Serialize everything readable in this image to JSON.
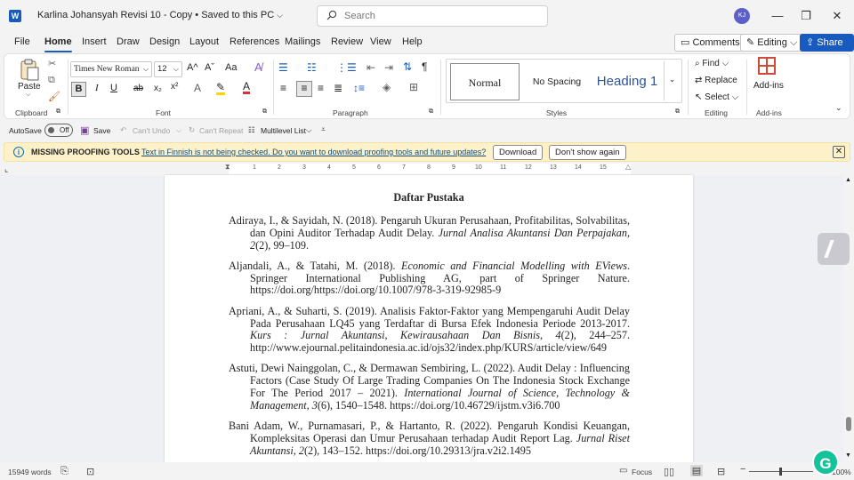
{
  "title_bar": {
    "app_icon": "W",
    "doc_name": "Karlina Johansyah Revisi 10 - Copy • Saved to this PC",
    "search_placeholder": "Search",
    "user_initials": "KJ",
    "minimize": "—",
    "restore": "❐",
    "close": "✕"
  },
  "menu": {
    "tabs": [
      "File",
      "Home",
      "Insert",
      "Draw",
      "Design",
      "Layout",
      "References",
      "Mailings",
      "Review",
      "View",
      "Help"
    ],
    "active_tab": "Home",
    "comments": "Comments",
    "editing": "Editing",
    "share": "Share"
  },
  "ribbon": {
    "clipboard": {
      "paste": "Paste",
      "label": "Clipboard"
    },
    "font": {
      "family": "Times New Roman",
      "size": "12",
      "label": "Font",
      "bold": "B",
      "italic": "I",
      "underline": "U",
      "strike": "ab",
      "sub": "x₂",
      "sup": "x²",
      "grow": "A^",
      "shrink": "Aˇ",
      "case": "Aa"
    },
    "paragraph": {
      "label": "Paragraph"
    },
    "styles": {
      "label": "Styles",
      "items": [
        "Normal",
        "No Spacing",
        "Heading 1"
      ]
    },
    "editing": {
      "label": "Editing",
      "find": "Find",
      "replace": "Replace",
      "select": "Select"
    },
    "addins": {
      "label": "Add-ins",
      "button": "Add-ins"
    }
  },
  "qat": {
    "autosave": "AutoSave",
    "autosave_state": "Off",
    "save": "Save",
    "undo": "Can't Undo",
    "repeat": "Can't Repeat",
    "multilevel": "Multilevel List"
  },
  "notification": {
    "title": "MISSING PROOFING TOOLS",
    "message": "Text in Finnish is not being checked. Do you want to download proofing tools and future updates?",
    "download": "Download",
    "dont_show": "Don't show again"
  },
  "ruler": {
    "numbers": [
      "1",
      "2",
      "3",
      "4",
      "5",
      "6",
      "7",
      "8",
      "9",
      "10",
      "11",
      "12",
      "13",
      "14",
      "15"
    ]
  },
  "document": {
    "heading": "Daftar Pustaka",
    "references": [
      {
        "a": "Adiraya, I., & Sayidah, N. (2018). Pengaruh Ukuran Perusahaan, Profitabilitas, Solvabilitas, dan Opini Auditor Terhadap Audit Delay. ",
        "i": "Jurnal Analisa Akuntansi Dan Perpajakan",
        "b": ", ",
        "vol": "2",
        "c": "(2), 99–109."
      },
      {
        "a": "Aljandali, A., & Tatahi, M. (2018). ",
        "i": "Economic and Financial Modelling with EViews",
        "b": ". Springer International Publishing AG, part of Springer Nature. https://doi.org/https://doi.org/10.1007/978-3-319-92985-9",
        "vol": "",
        "c": ""
      },
      {
        "a": "Apriani, A., & Suharti, S. (2019). Analisis Faktor-Faktor yang Mempengaruhi Audit Delay Pada Perusahaan LQ45 yang Terdaftar di Bursa Efek Indonesia Periode 2013-2017. ",
        "i": "Kurs : Jurnal Akuntansi, Kewirausahaan Dan Bisnis",
        "b": ", ",
        "vol": "4",
        "c": "(2), 244–257. http://www.ejournal.pelitaindonesia.ac.id/ojs32/index.php/KURS/article/view/649"
      },
      {
        "a": "Astuti, Dewi Nainggolan, C., & Dermawan Sembiring, L. (2022). Audit Delay : Influencing Factors (Case Study Of Large Trading Companies On The Indonesia Stock Exchange For The Period 2017 – 2021). ",
        "i": "International Journal of Science, Technology & Management",
        "b": ", ",
        "vol": "3",
        "c": "(6), 1540–1548. https://doi.org/10.46729/ijstm.v3i6.700"
      },
      {
        "a": "Bani Adam, W., Purnamasari, P., & Hartanto, R. (2022). Pengaruh Kondisi Keuangan, Kompleksitas Operasi dan Umur Perusahaan terhadap Audit Report Lag. ",
        "i": "Jurnal Riset Akuntansi",
        "b": ", ",
        "vol": "2",
        "c": "(2), 143–152. https://doi.org/10.29313/jra.v2i2.1495"
      }
    ]
  },
  "status": {
    "words": "15949 words",
    "focus": "Focus",
    "zoom": "100%",
    "zoom_minus": "−",
    "zoom_plus": "+"
  },
  "grammarly": "G",
  "colors": {
    "accent": "#185abd",
    "notify_bg": "#fcf1c8",
    "heading_style": "#2f5496",
    "grammarly": "#15c39a"
  }
}
